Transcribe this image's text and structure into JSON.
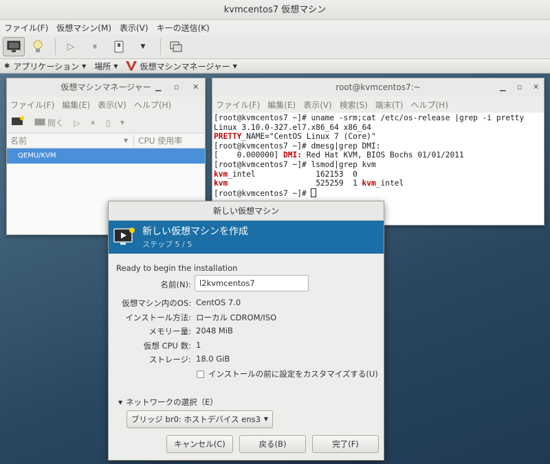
{
  "outer": {
    "title": "kvmcentos7 仮想マシン",
    "menu": [
      "ファイル(F)",
      "仮想マシン(M)",
      "表示(V)",
      "キーの送信(K)"
    ]
  },
  "panel": {
    "applications": "アプリケーション",
    "places": "場所",
    "vmm": "仮想マシンマネージャー"
  },
  "vmm": {
    "title": "仮想マシンマネージャー",
    "menu": [
      "ファイル(F)",
      "編集(E)",
      "表示(V)",
      "ヘルプ(H)"
    ],
    "open_label": "開く",
    "col_name": "名前",
    "col_cpu": "CPU 使用率",
    "row": "QEMU/KVM"
  },
  "terminal": {
    "title": "root@kvmcentos7:~",
    "menu": [
      "ファイル(F)",
      "編集(E)",
      "表示(V)",
      "検索(S)",
      "端末(T)",
      "ヘルプ(H)"
    ],
    "lines": {
      "l1": "[root@kvmcentos7 ~]# uname -srm;cat /etc/os-release |grep -i pretty",
      "l2": "Linux 3.10.0-327.el7.x86_64 x86_64",
      "l3a": "PRETTY",
      "l3b": "_NAME=\"CentOS Linux 7 (Core)\"",
      "l4": "[root@kvmcentos7 ~]# dmesg|grep DMI:",
      "l5a": "[    0.000000] ",
      "l5b": "DMI:",
      "l5c": " Red Hat KVM, BIOS Bochs 01/01/2011",
      "l6": "[root@kvmcentos7 ~]# lsmod|grep kvm",
      "l7a": "kvm",
      "l7b": "_intel             162153  0",
      "l8a": "kvm",
      "l8b": "                   525259  1 ",
      "l8c": "kvm",
      "l8d": "_intel",
      "l9": "[root@kvmcentos7 ~]# "
    }
  },
  "dialog": {
    "title": "新しい仮想マシン",
    "banner_title": "新しい仮想マシンを作成",
    "banner_step": "ステップ 5 / 5",
    "ready": "Ready to begin the installation",
    "name_label": "名前(N):",
    "name_value": "l2kvmcentos7",
    "os_label": "仮想マシン内のOS:",
    "os_value": "CentOS 7.0",
    "install_label": "インストール方法:",
    "install_value": "ローカル CDROM/ISO",
    "memory_label": "メモリー量:",
    "memory_value": "2048 MiB",
    "cpu_label": "仮想 CPU 数:",
    "cpu_value": "1",
    "storage_label": "ストレージ:",
    "storage_value": "18.0 GiB",
    "customize_label": "インストールの前に設定をカスタマイズする(U)",
    "network_label": "ネットワークの選択（E）",
    "network_value": "ブリッジ br0: ホストデバイス ens3",
    "cancel": "キャンセル(C)",
    "back": "戻る(B)",
    "finish": "完了(F)"
  },
  "colors": {
    "banner": "#1b6fa6",
    "selection": "#4a90d9",
    "terminal_highlight": "#c00000"
  }
}
